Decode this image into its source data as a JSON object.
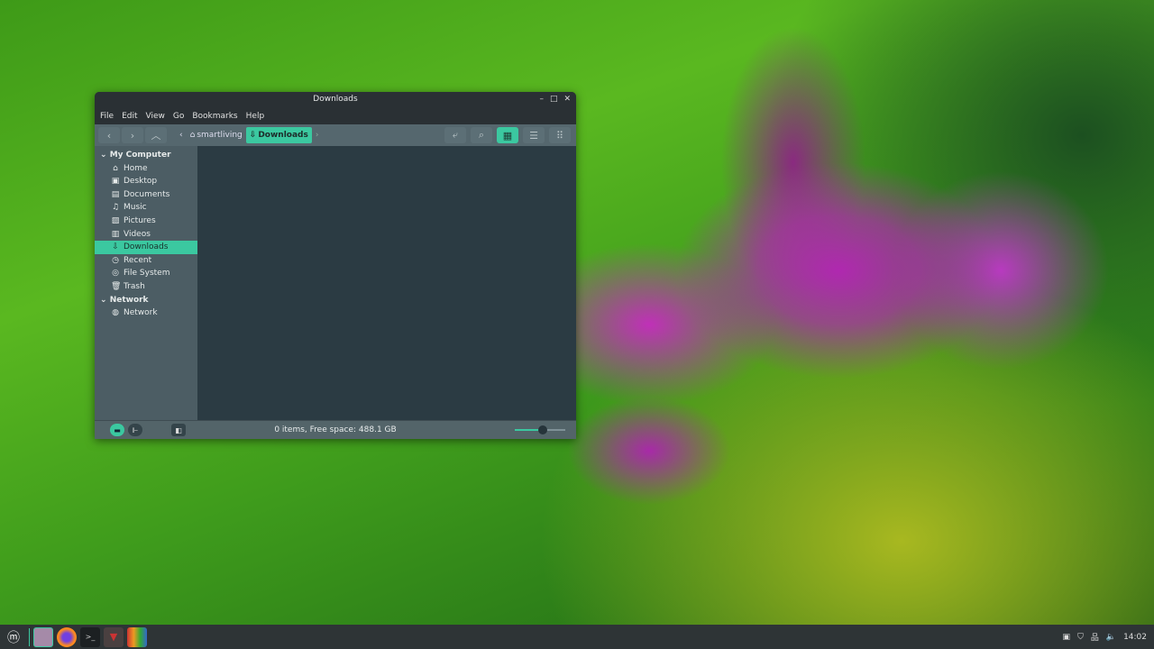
{
  "window": {
    "title": "Downloads",
    "min": "–",
    "max": "□",
    "close": "✕"
  },
  "menu": [
    "File",
    "Edit",
    "View",
    "Go",
    "Bookmarks",
    "Help"
  ],
  "toolbar": {
    "back": "‹",
    "forward": "›",
    "up": "︿",
    "crumb_prev": "‹",
    "crumb_next": "›",
    "crumbs": [
      "smartliving",
      "Downloads"
    ],
    "terminal": "⤶",
    "search": "⌕",
    "icon_view": "▦",
    "list_view": "☰",
    "compact_view": "⠿"
  },
  "sidebar": {
    "sections": [
      {
        "label": "My Computer",
        "items": [
          {
            "label": "Home",
            "icon": "⌂"
          },
          {
            "label": "Desktop",
            "icon": "▣"
          },
          {
            "label": "Documents",
            "icon": "▤"
          },
          {
            "label": "Music",
            "icon": "♫"
          },
          {
            "label": "Pictures",
            "icon": "▨"
          },
          {
            "label": "Videos",
            "icon": "▥"
          },
          {
            "label": "Downloads",
            "icon": "⇩",
            "selected": true
          },
          {
            "label": "Recent",
            "icon": "◷"
          },
          {
            "label": "File System",
            "icon": "◎"
          },
          {
            "label": "Trash",
            "icon": "🗑"
          }
        ]
      },
      {
        "label": "Network",
        "items": [
          {
            "label": "Network",
            "icon": "◍"
          }
        ]
      }
    ]
  },
  "status": {
    "text": "0 items, Free space: 488.1 GB",
    "zoom_level": 0.55
  },
  "taskbar": {
    "clock": "14:02"
  }
}
